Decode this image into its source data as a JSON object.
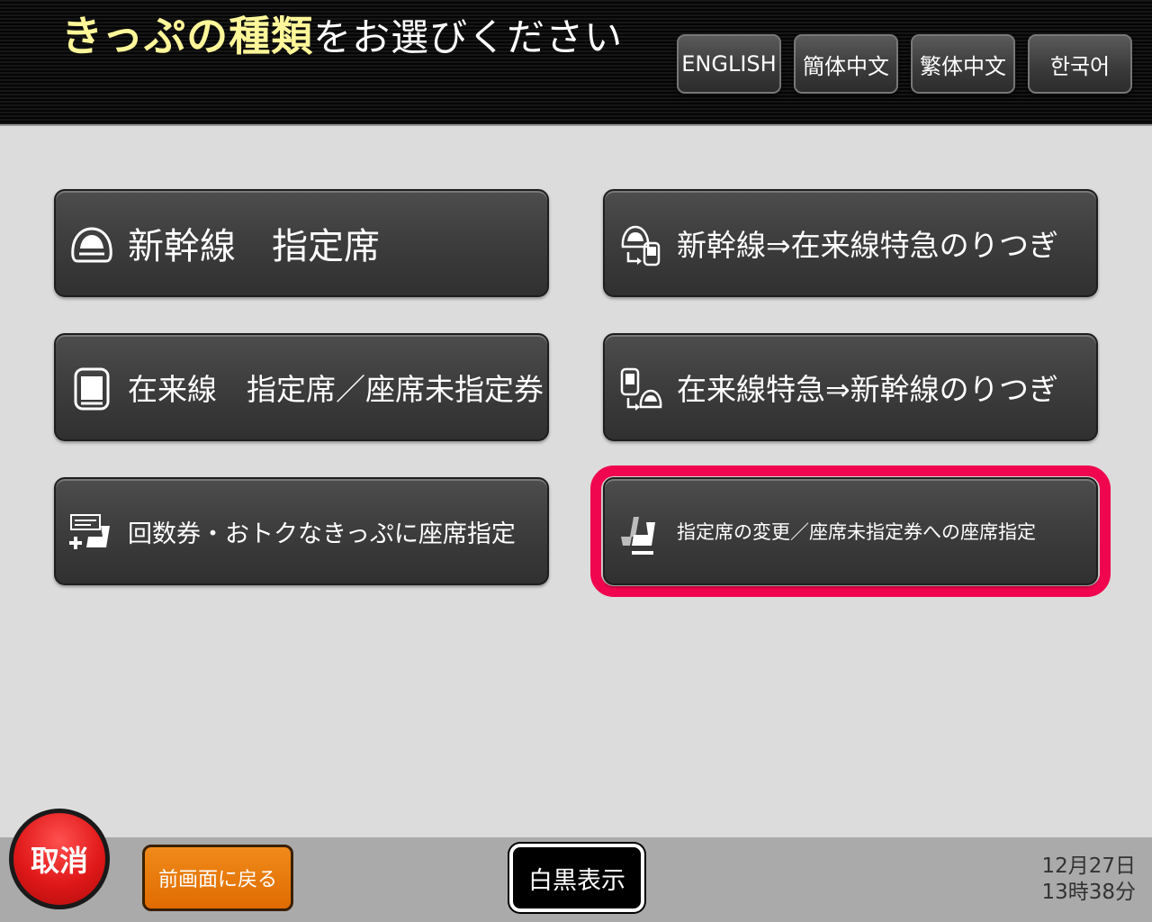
{
  "header": {
    "title_highlight": "きっぷの種類",
    "title_rest": "をお選びください",
    "languages": [
      "ENGLISH",
      "簡体中文",
      "繁体中文",
      "한국어"
    ]
  },
  "menu": {
    "items": [
      {
        "label": "新幹線　指定席",
        "icon": "shinkansen-icon"
      },
      {
        "label": "新幹線⇒在来線特急のりつぎ",
        "icon": "shinkansen-to-limited-express-icon"
      },
      {
        "label": "在来線　指定席／座席未指定券",
        "icon": "conventional-train-icon"
      },
      {
        "label": "在来線特急⇒新幹線のりつぎ",
        "icon": "limited-express-to-shinkansen-icon"
      },
      {
        "label": "回数券・おトクなきっぷに座席指定",
        "icon": "ticket-seat-add-icon"
      },
      {
        "label": "指定席の変更／座席未指定券への座席指定",
        "icon": "seat-change-icon"
      }
    ],
    "highlighted_index": 5
  },
  "footer": {
    "cancel_label": "取消",
    "back_label": "前画面に戻る",
    "mono_label": "白黒表示",
    "date": "12月27日",
    "time": "13時38分"
  },
  "colors": {
    "title_highlight": "#fff79a",
    "highlight_ring": "#f0064e",
    "cancel": "#e01818",
    "back": "#e06c00"
  }
}
